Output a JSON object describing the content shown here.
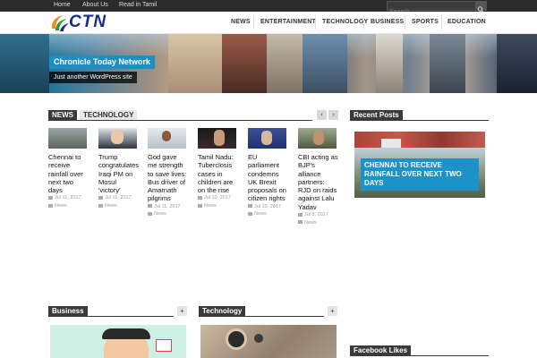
{
  "topbar": {
    "links": [
      "Home",
      "About Us",
      "Read in Tamil"
    ],
    "search_placeholder": "Search..."
  },
  "header": {
    "logo_text": "CTN",
    "nav": [
      "NEWS",
      "ENTERTAINMENT",
      "TECHNOLOGY",
      "BUSINESS",
      "SPORTS",
      "EDUCATION"
    ]
  },
  "banner": {
    "title": "Chronicle Today Network",
    "subtitle": "Just another WordPress site"
  },
  "news_section": {
    "tab_active": "NEWS",
    "tab_second": "TECHNOLOGY",
    "prev_label": "‹",
    "next_label": "›",
    "cards": [
      {
        "title": "Chennai to receive rainfall over next two days",
        "date": "Jul 11, 2017",
        "category": "News"
      },
      {
        "title": "Trump congratulates Iraqi PM on Mosul 'victory'",
        "date": "Jul 11, 2017",
        "category": "News"
      },
      {
        "title": "God gave me strength to save lives: Bus driver of Amarnath pilgrims",
        "date": "Jul 11, 2017",
        "category": "News"
      },
      {
        "title": "Tamil Nadu: Tuberclosis cases in children are on the rise",
        "date": "Jul 10, 2017",
        "category": "News"
      },
      {
        "title": "EU parliament condemns UK Brexit proposals on citizen rights",
        "date": "Jul 10, 2017",
        "category": "News"
      },
      {
        "title": "CBI acting as BJP's alliance partners: RJD on raids against Lalu Yadav",
        "date": "Jul 8, 2017",
        "category": "News"
      }
    ]
  },
  "recent_posts": {
    "heading": "Recent Posts",
    "caption": "CHENNAI TO RECEIVE RAINFALL OVER NEXT TWO DAYS"
  },
  "business": {
    "heading": "Business",
    "plus_label": "+"
  },
  "technology": {
    "heading": "Technology",
    "plus_label": "+"
  },
  "facebook": {
    "heading": "Facebook Likes"
  },
  "colors": {
    "accent_blue": "#1d92c8",
    "dark_tag": "#3a3a3a",
    "logo_navy": "#1a2c8a"
  },
  "icons": [
    "search-icon",
    "clock-icon",
    "folder-icon"
  ]
}
